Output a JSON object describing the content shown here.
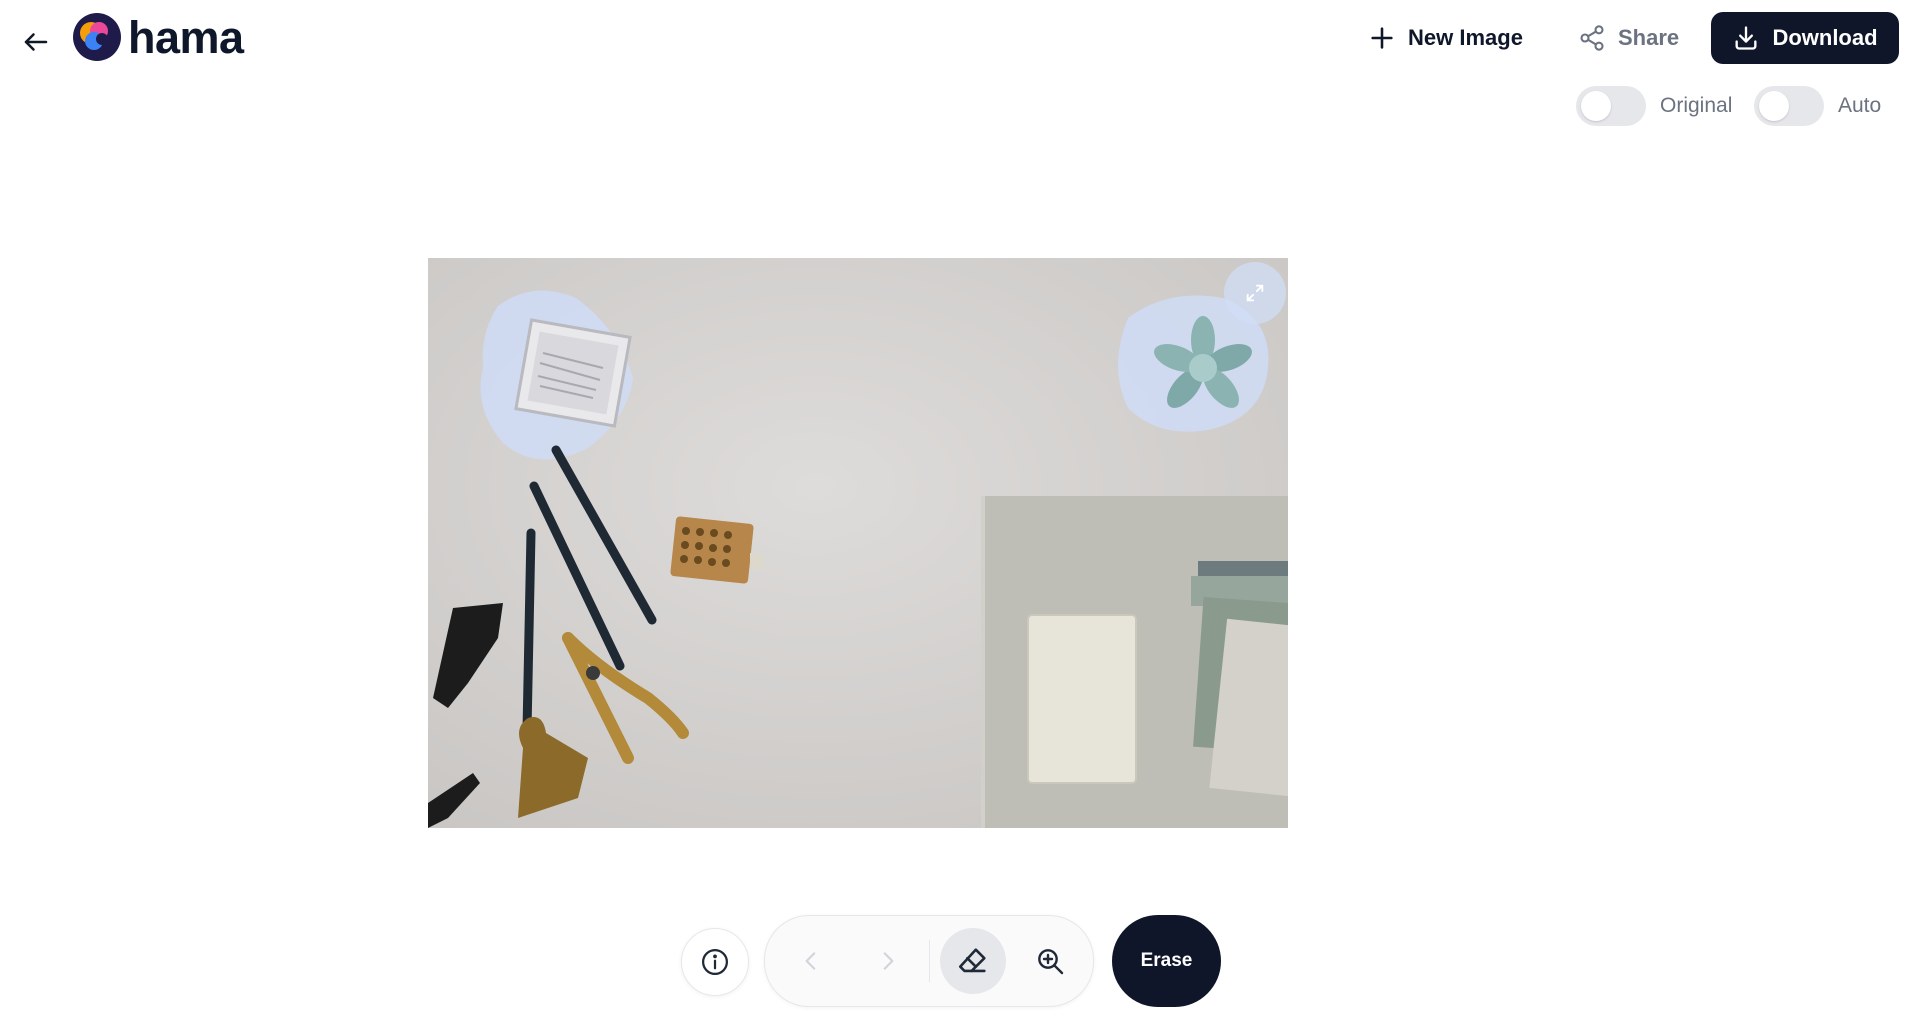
{
  "app": {
    "logo_text": "hama"
  },
  "header": {
    "new_image_label": "New Image",
    "share_label": "Share",
    "download_label": "Download"
  },
  "toggles": [
    {
      "label": "Original",
      "on": false
    },
    {
      "label": "Auto",
      "on": false
    }
  ],
  "toolbar": {
    "erase_label": "Erase"
  },
  "icons": [
    "arrow-left-icon",
    "plus-icon",
    "share-icon",
    "download-icon",
    "expand-icon",
    "info-icon",
    "chevron-left-icon",
    "chevron-right-icon",
    "eraser-icon",
    "zoom-in-icon"
  ],
  "colors": {
    "primary": "#0f1629",
    "mask_highlight": "#cfdcf6",
    "toggle_off": "#e5e7eb"
  }
}
